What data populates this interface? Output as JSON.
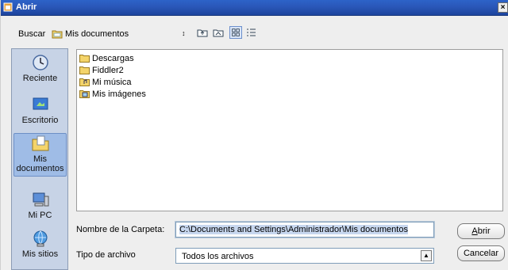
{
  "window": {
    "title": "Abrir",
    "close_glyph": "×"
  },
  "toolbar": {
    "look_in_label": "Buscar",
    "look_in_value": "Mis documentos",
    "buttons": [
      "up-folder-icon",
      "home-folder-icon",
      "new-folder-icon",
      "list-view-icon",
      "details-view-icon"
    ]
  },
  "places": [
    {
      "label": "Reciente",
      "icon": "clock-icon"
    },
    {
      "label": "Escritorio",
      "icon": "desktop-icon"
    },
    {
      "label": "Mis documentos",
      "icon": "documents-folder-icon",
      "selected": true
    },
    {
      "label": "Mi PC",
      "icon": "computer-icon"
    },
    {
      "label": "Mis sitios",
      "icon": "network-icon"
    }
  ],
  "files": [
    {
      "name": "Descargas",
      "icon": "folder-icon"
    },
    {
      "name": "Fiddler2",
      "icon": "folder-icon"
    },
    {
      "name": "Mi música",
      "icon": "music-folder-icon"
    },
    {
      "name": "Mis imágenes",
      "icon": "pictures-folder-icon"
    }
  ],
  "folder_name": {
    "label": "Nombre de la Carpeta:",
    "value": "C:\\Documents and Settings\\Administrador\\Mis documentos"
  },
  "file_type": {
    "label": "Tipo de archivo",
    "value": "Todos los archivos"
  },
  "buttons": {
    "open": "Abrir",
    "open_mnemonic": "A",
    "open_rest": "brir",
    "cancel": "Cancelar"
  },
  "colors": {
    "titlebar": "#2a57b8",
    "places_panel": "#c7d3e6",
    "places_selected": "#9fbce6"
  }
}
